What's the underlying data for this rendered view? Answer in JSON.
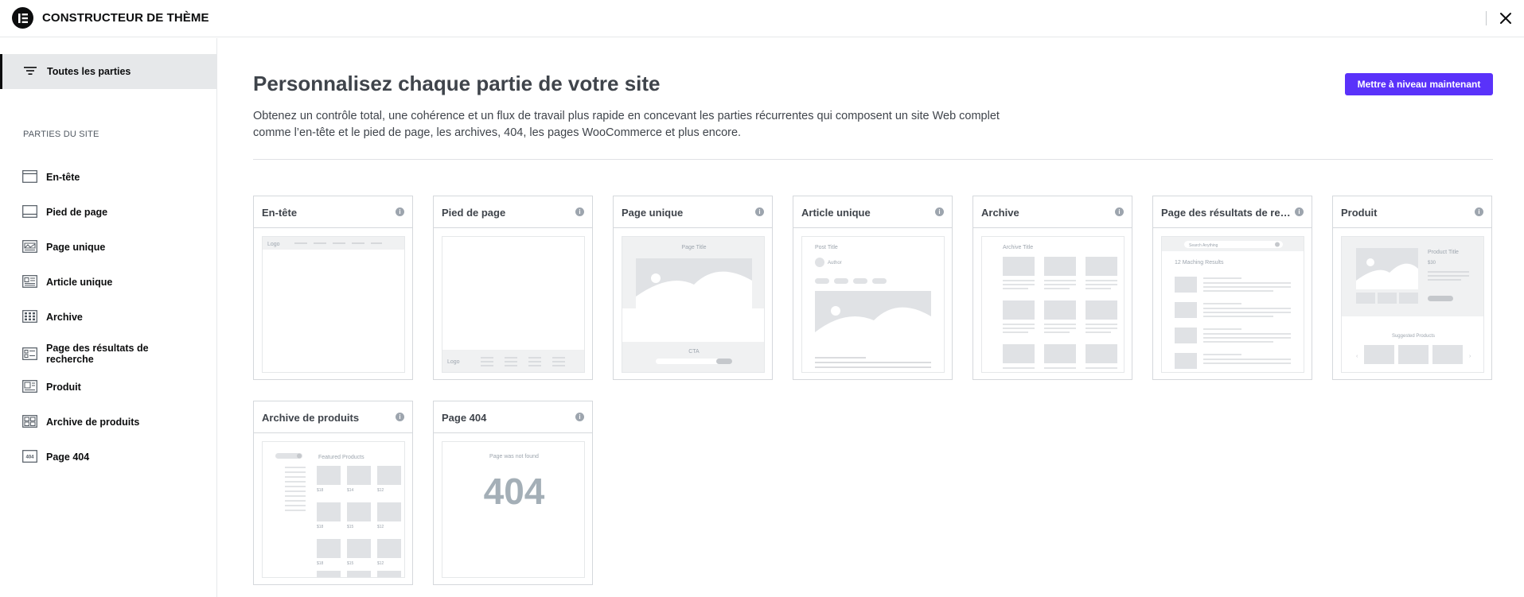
{
  "app": {
    "title": "CONSTRUCTEUR DE THÈME"
  },
  "sidebar": {
    "all_parts_label": "Toutes les parties",
    "section_heading": "PARTIES DU SITE",
    "items": [
      {
        "label": "En-tête",
        "icon": "header-icon"
      },
      {
        "label": "Pied de page",
        "icon": "footer-icon"
      },
      {
        "label": "Page unique",
        "icon": "single-page-icon"
      },
      {
        "label": "Article unique",
        "icon": "single-post-icon"
      },
      {
        "label": "Archive",
        "icon": "archive-icon"
      },
      {
        "label": "Page des résultats de recherche",
        "icon": "search-results-icon"
      },
      {
        "label": "Produit",
        "icon": "product-icon"
      },
      {
        "label": "Archive de produits",
        "icon": "products-archive-icon"
      },
      {
        "label": "Page 404",
        "icon": "error-404-icon"
      }
    ]
  },
  "main": {
    "title": "Personnalisez chaque partie de votre site",
    "description": "Obtenez un contrôle total, une cohérence et un flux de travail plus rapide en concevant les parties récurrentes qui composent un site Web complet comme l’en-tête et le pied de page, les archives, 404, les pages WooCommerce et plus encore.",
    "upgrade_label": "Mettre à niveau maintenant",
    "accent_color": "#5a32fa",
    "cards": [
      {
        "title": "En-tête",
        "thumb_text": [
          "Logo"
        ]
      },
      {
        "title": "Pied de page",
        "thumb_text": [
          "Logo"
        ]
      },
      {
        "title": "Page unique",
        "thumb_text": [
          "Page Title",
          "CTA"
        ]
      },
      {
        "title": "Article unique",
        "thumb_text": [
          "Post Title",
          "Author"
        ]
      },
      {
        "title": "Archive",
        "thumb_text": [
          "Archive Title"
        ]
      },
      {
        "title": "Page des résultats de recherche",
        "thumb_text": [
          "Search Anything",
          "12 Maching Results"
        ]
      },
      {
        "title": "Produit",
        "thumb_text": [
          "Product Title",
          "$30",
          "Suggested Products"
        ]
      },
      {
        "title": "Archive de produits",
        "thumb_text": [
          "Featured Products",
          "$18",
          "$14",
          "$12",
          "$18",
          "$15",
          "$12",
          "$18",
          "$15",
          "$12"
        ]
      },
      {
        "title": "Page 404",
        "thumb_text": [
          "Page was not found",
          "404"
        ]
      }
    ]
  }
}
